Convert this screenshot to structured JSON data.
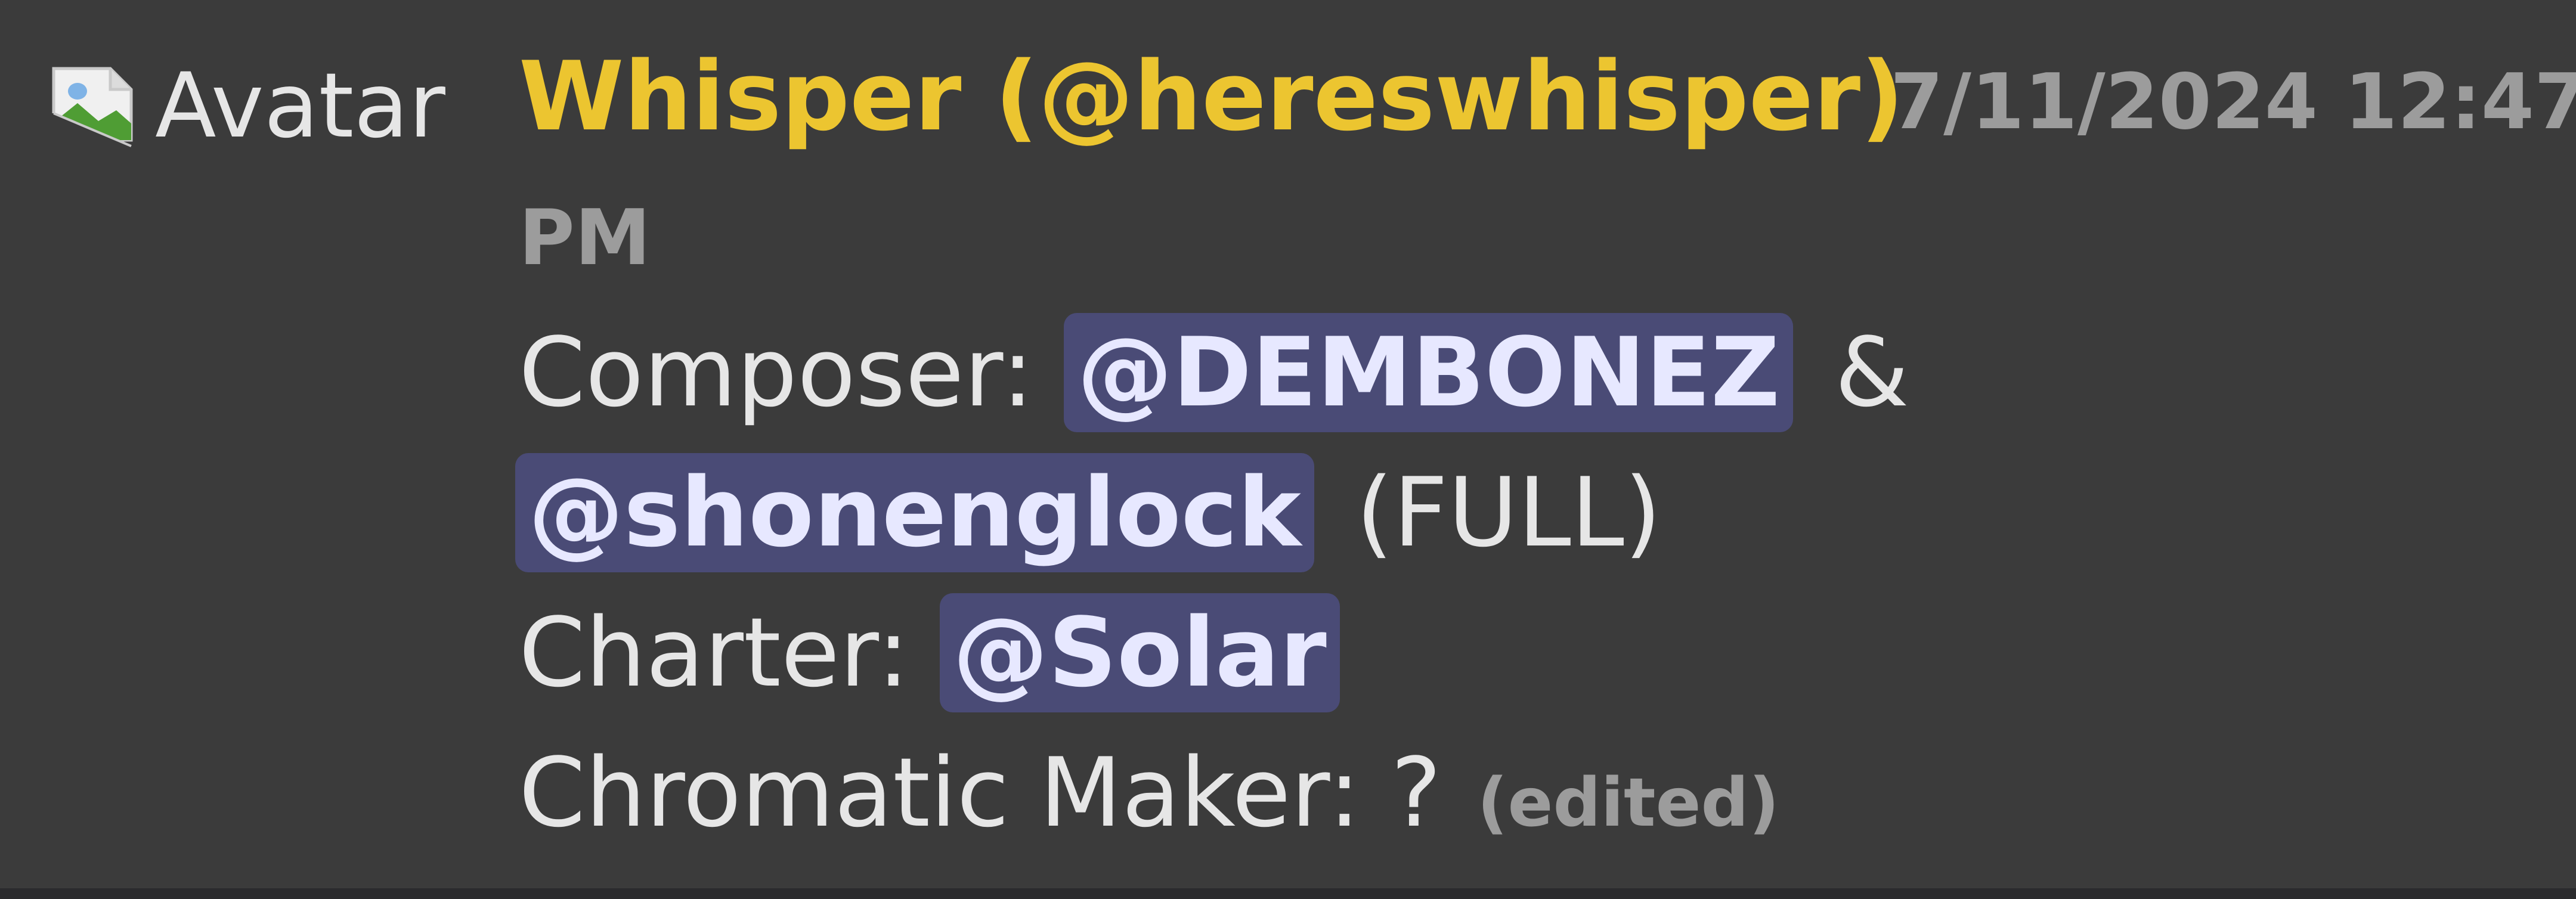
{
  "avatar": {
    "alt_text": "Avatar",
    "icon": "broken-image-icon"
  },
  "message": {
    "author": "Whisper (@hereswhisper)",
    "timestamp_line1": "7/11/2024 12:47",
    "timestamp_line2": "PM",
    "lines": [
      {
        "label": "Composer:",
        "mention": "@DEMBONEZ",
        "connector": "&"
      },
      {
        "mention": "@shonenglock",
        "suffix": "(FULL)"
      },
      {
        "label": "Charter:",
        "mention": "@Solar"
      },
      {
        "label": "Chromatic Maker: ?",
        "edited": "(edited)"
      }
    ]
  },
  "colors": {
    "background": "#3b3b3b",
    "author": "#ecc530",
    "timestamp": "#9c9c9c",
    "text": "#e6e6e6",
    "mention_bg": "#4a4b76",
    "mention_text": "#e7e8ff"
  }
}
